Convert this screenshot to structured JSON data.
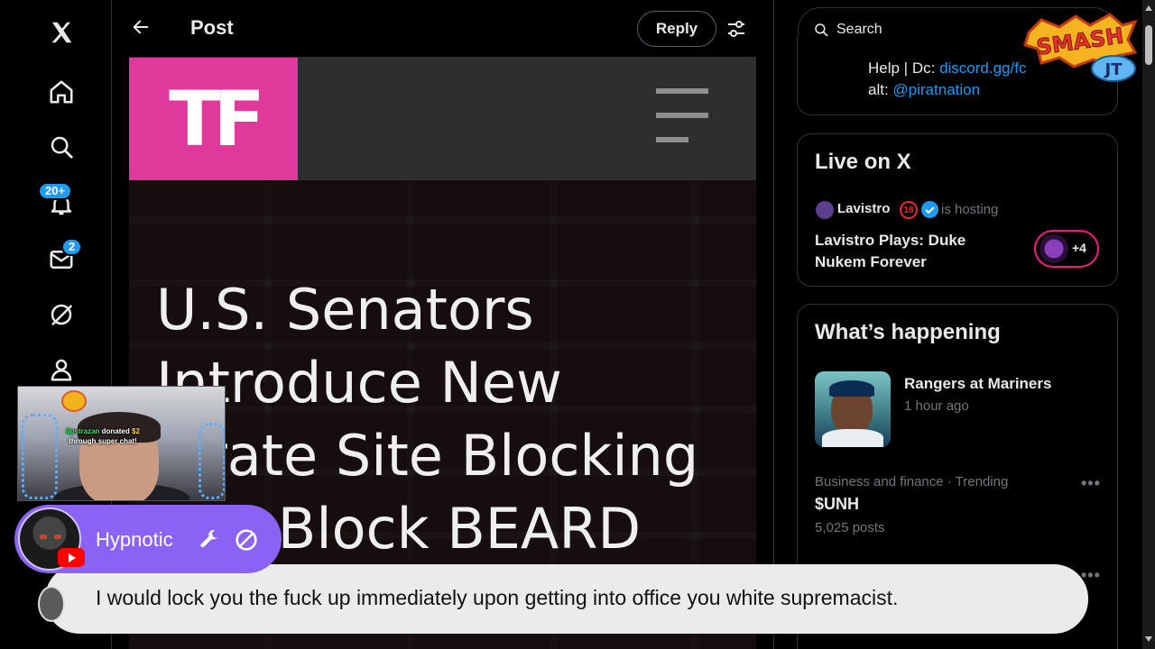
{
  "header": {
    "title": "Post",
    "reply_label": "Reply"
  },
  "left_nav": {
    "notifications_badge": "20+",
    "messages_badge": "2"
  },
  "article": {
    "logo_text": "TF",
    "headline_lines": [
      "U.S. Senators",
      "Introduce New",
      "Pirate Site Blocking",
      "Bill: Block BEARD"
    ]
  },
  "right": {
    "search_placeholder": "Search",
    "profile_snippet": {
      "help_prefix": "Help | Dc: ",
      "help_link": "discord.gg/fc",
      "alt_prefix": "alt: ",
      "alt_link": "@piratnation"
    },
    "live": {
      "title": "Live on X",
      "host_name": "Lavistro",
      "host_badge": "18",
      "hosting_text": "is hosting",
      "stream_title": "Lavistro Plays: Duke Nukem Forever",
      "listeners": "+4"
    },
    "happening": {
      "title": "What’s happening",
      "items": [
        {
          "headline": "Rangers at Mariners",
          "time": "1 hour ago"
        },
        {
          "context": "Business and finance · Trending",
          "topic": "$UNH",
          "posts": "5,025 posts"
        }
      ]
    }
  },
  "overlay": {
    "brand_logo": "SMASH JT",
    "donation": {
      "donor": "lipstrazan",
      "text_mid": " donated ",
      "amount": "$2",
      "text_tail": "through super chat!"
    },
    "chat_author": "Hypnotic",
    "chat_message": "I would lock you the fuck up immediately upon getting into office you white supremacist."
  },
  "colors": {
    "accent": "#1d9bf0",
    "tf_pink": "#e0399c",
    "chat_pill": "#8a63f4",
    "live_ring": "#f91880"
  }
}
